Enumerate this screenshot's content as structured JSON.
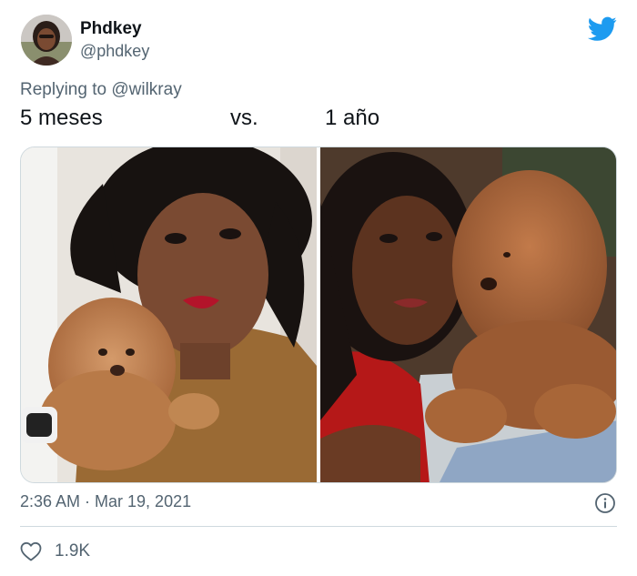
{
  "tweet": {
    "display_name": "Phdkey",
    "handle": "@phdkey",
    "replying_prefix": "Replying to ",
    "replying_to": "@wilkray",
    "text": {
      "left": "5 meses",
      "middle": "vs.",
      "right": "1 año"
    },
    "timestamp": "2:36 AM · Mar 19, 2021",
    "likes": "1.9K"
  },
  "icons": {
    "brand": "twitter-bird-icon",
    "info": "info-icon",
    "like": "heart-icon"
  },
  "colors": {
    "brand_blue": "#1d9bf0",
    "secondary_text": "#536471",
    "primary_text": "#0f1419",
    "divider": "#cfd9de"
  }
}
